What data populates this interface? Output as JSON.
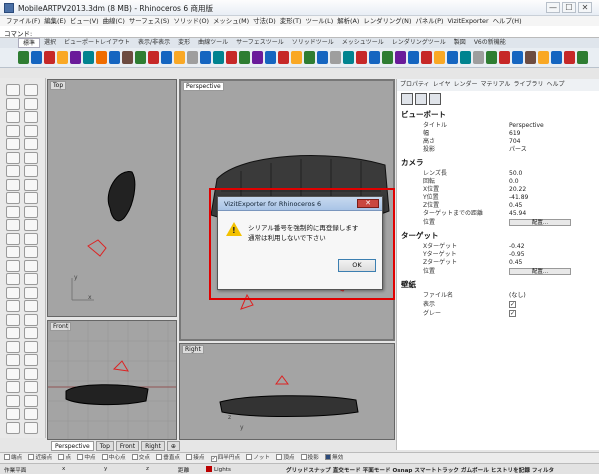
{
  "window": {
    "title": "MobileARTPV2013.3dm (8 MB) - Rhinoceros 6 商用版",
    "min": "—",
    "max": "☐",
    "close": "✕"
  },
  "menu": [
    "ファイル(F)",
    "編集(E)",
    "ビュー(V)",
    "曲線(C)",
    "サーフェス(S)",
    "ソリッド(O)",
    "メッシュ(M)",
    "寸法(D)",
    "変形(T)",
    "ツール(L)",
    "解析(A)",
    "レンダリング(N)",
    "パネル(P)",
    "VizitExporter",
    "ヘルプ(H)"
  ],
  "command": {
    "label": "コマンド:"
  },
  "toolbar_tabs": [
    "標準",
    "選択",
    "ビューポートレイアウト",
    "表示/非表示",
    "変形",
    "曲線ツール",
    "サーフェスツール",
    "ソリッドツール",
    "メッシュツール",
    "レンダリングツール",
    "製図",
    "V6の新機能"
  ],
  "toolbar_icon_colors": [
    "#2e7d32",
    "#1565c0",
    "#c62828",
    "#f9a825",
    "#6a1b9a",
    "#00838f",
    "#ef6c00",
    "#1565c0",
    "#6d4c41",
    "#2e7d32",
    "#c62828",
    "#1565c0",
    "#f9a825",
    "#9e9e9e",
    "#1565c0",
    "#00838f",
    "#c62828",
    "#2e7d32",
    "#6a1b9a",
    "#1565c0",
    "#c62828",
    "#f9a825",
    "#2e7d32",
    "#1565c0",
    "#9e9e9e",
    "#00838f",
    "#c62828",
    "#1565c0",
    "#2e7d32",
    "#6a1b9a",
    "#1565c0",
    "#c62828",
    "#f9a825",
    "#1565c0",
    "#00838f",
    "#9e9e9e",
    "#2e7d32",
    "#c62828",
    "#1565c0",
    "#6d4c41",
    "#f9a825",
    "#1565c0",
    "#c62828",
    "#2e7d32"
  ],
  "viewports": {
    "top": "Top",
    "perspective": "Perspective",
    "front": "Front",
    "right": "Right",
    "axis_x": "x",
    "axis_y": "y",
    "axis_z": "z"
  },
  "viewport_tabs": [
    "Perspective",
    "Top",
    "Front",
    "Right"
  ],
  "viewport_tab_add": "⊕",
  "panel": {
    "tabs": [
      "プロパティ",
      "レイヤ",
      "レンダー",
      "マテリアル",
      "ライブラリ",
      "ヘルプ"
    ],
    "section_viewport": "ビューポート",
    "viewport_rows": [
      {
        "k": "タイトル",
        "v": "Perspective"
      },
      {
        "k": "幅",
        "v": "619"
      },
      {
        "k": "高さ",
        "v": "704"
      },
      {
        "k": "投影",
        "v": "パース"
      }
    ],
    "section_camera": "カメラ",
    "camera_rows": [
      {
        "k": "レンズ長",
        "v": "50.0"
      },
      {
        "k": "回転",
        "v": "0.0"
      },
      {
        "k": "X位置",
        "v": "20.22"
      },
      {
        "k": "Y位置",
        "v": "-41.89"
      },
      {
        "k": "Z位置",
        "v": "0.45"
      },
      {
        "k": "ターゲットまでの距離",
        "v": "45.94"
      }
    ],
    "position_label": "位置",
    "place_button": "配置...",
    "section_target": "ターゲット",
    "target_rows": [
      {
        "k": "Xターゲット",
        "v": "-0.42"
      },
      {
        "k": "Yターゲット",
        "v": "-0.95"
      },
      {
        "k": "Zターゲット",
        "v": "0.45"
      }
    ],
    "section_wallpaper": "壁紙",
    "wallpaper_file_label": "ファイル名",
    "wallpaper_file_value": "(なし)",
    "wallpaper_show_label": "表示",
    "wallpaper_gray_label": "グレー",
    "check_mark": "✓"
  },
  "dialog": {
    "title": "VizitExporter for Rhinoceros 6",
    "close": "✕",
    "message_1": "シリアル番号を強制的に再登録します",
    "message_2": "通常は利用しないで下さい",
    "ok": "OK"
  },
  "osnap": [
    "端点",
    "近接点",
    "点",
    "中点",
    "中心点",
    "交点",
    "垂直点",
    "接点",
    "四半円点",
    "ノット",
    "頂点",
    "投影",
    "無効"
  ],
  "status": {
    "plane": "作業平面",
    "x": "x",
    "y": "y",
    "z": "z",
    "distance": "距離",
    "layer": "Lights",
    "modes": "グリッドスナップ 直交モード 平面モード Osnap スマートトラック ガムボール ヒストリを記録 フィルタ"
  }
}
